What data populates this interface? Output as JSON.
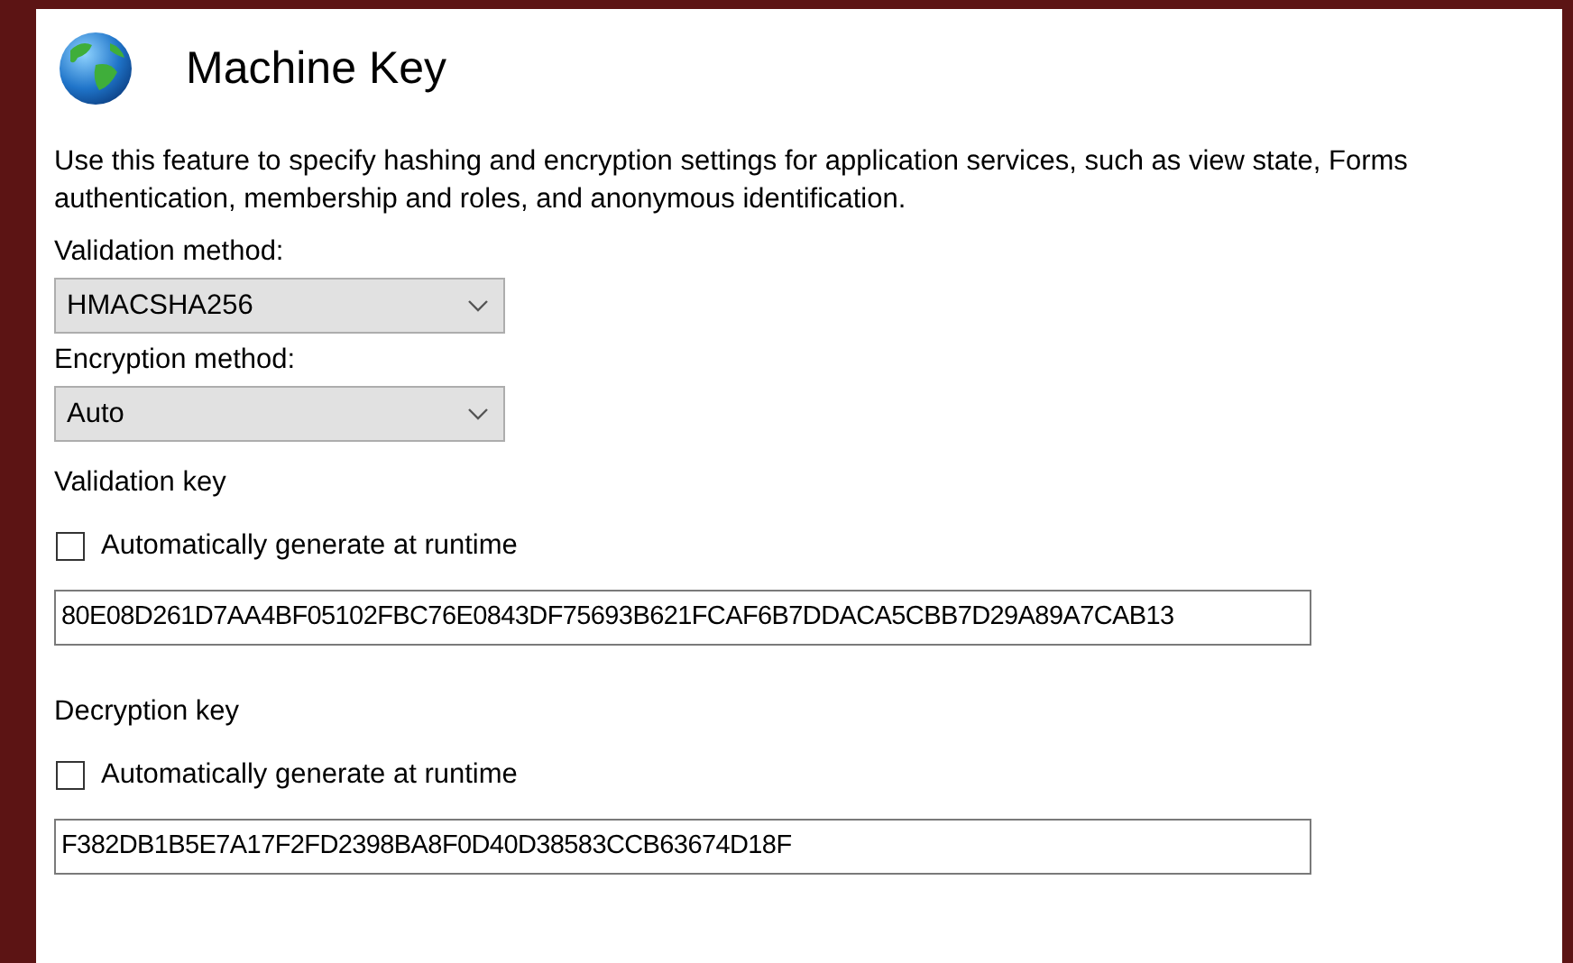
{
  "header": {
    "title": "Machine Key"
  },
  "description": "Use this feature to specify hashing and encryption settings for application services, such as view state, Forms authentication, membership and roles, and anonymous identification.",
  "methods": [
    {
      "label": "Validation method:",
      "value": "HMACSHA256"
    },
    {
      "label": "Encryption method:",
      "value": "Auto"
    }
  ],
  "keys": [
    {
      "label": "Validation key",
      "auto_generate": {
        "label": "Automatically generate at runtime",
        "checked": false
      },
      "value": "80E08D261D7AA4BF05102FBC76E0843DF75693B621FCAF6B7DDACA5CBB7D29A89A7CAB13"
    },
    {
      "label": "Decryption key",
      "auto_generate": {
        "label": "Automatically generate at runtime",
        "checked": false
      },
      "value": "F382DB1B5E7A17F2FD2398BA8F0D40D38583CCB63674D18F"
    }
  ]
}
